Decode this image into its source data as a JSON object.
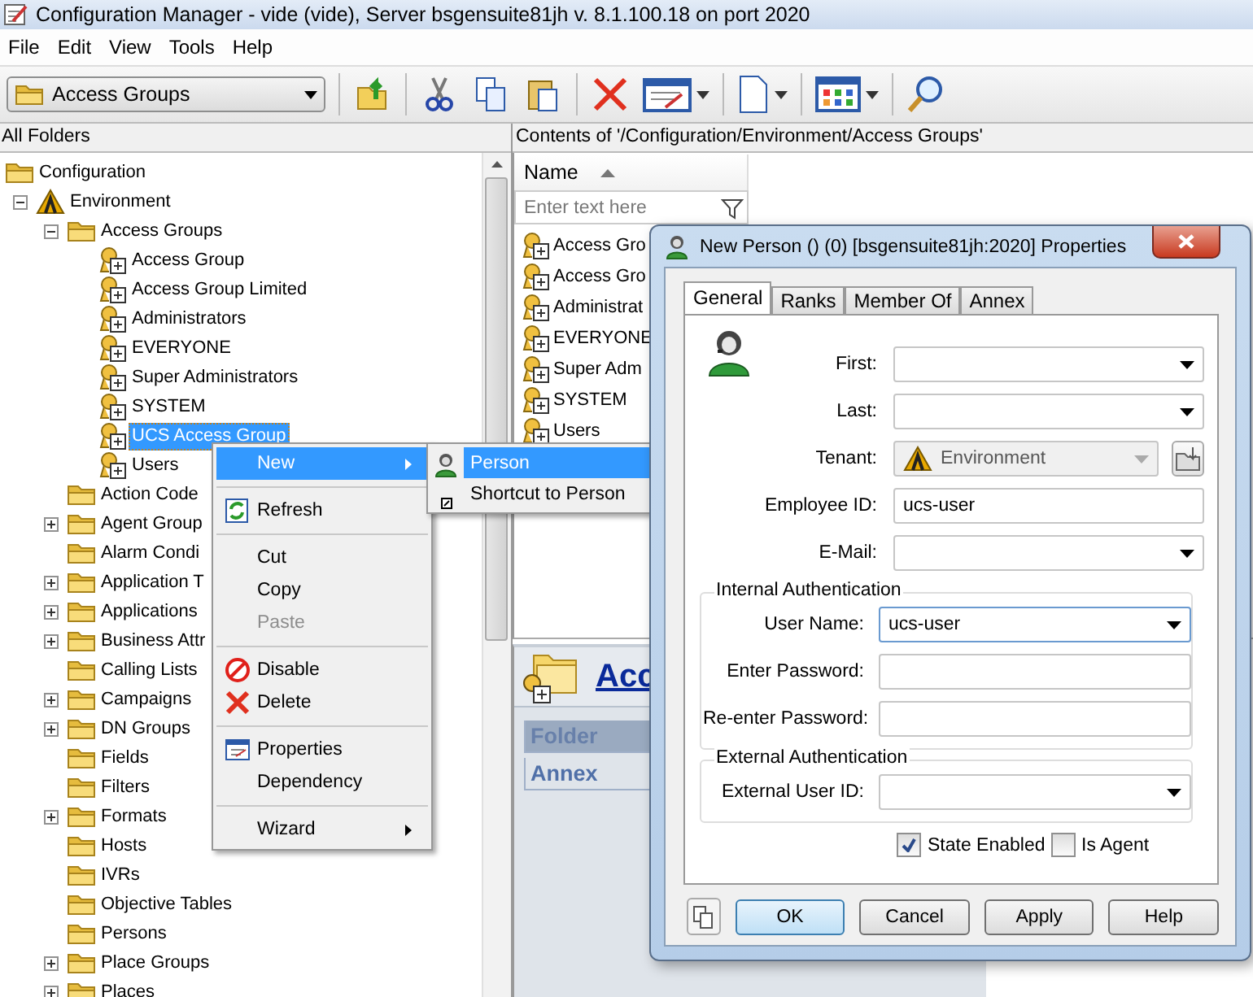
{
  "window": {
    "title": "Configuration Manager - vide  (vide), Server bsgensuite81jh v. 8.1.100.18 on port 2020"
  },
  "menu_bar": [
    "File",
    "Edit",
    "View",
    "Tools",
    "Help"
  ],
  "toolbar": {
    "folder_selector": "Access Groups"
  },
  "folders_pane": {
    "title": "All Folders",
    "tree": [
      {
        "label": "Configuration",
        "kind": "folder",
        "selected": false,
        "children": [
          {
            "label": "Environment",
            "kind": "tenant",
            "selected": false,
            "expanded": true,
            "children": [
              {
                "label": "Access Groups",
                "kind": "folder",
                "selected": false,
                "expanded": true,
                "children": [
                  {
                    "label": "Access Group",
                    "kind": "access-group",
                    "selected": false
                  },
                  {
                    "label": "Access Group Limited",
                    "kind": "access-group",
                    "selected": false
                  },
                  {
                    "label": "Administrators",
                    "kind": "access-group",
                    "selected": false
                  },
                  {
                    "label": "EVERYONE",
                    "kind": "access-group",
                    "selected": false
                  },
                  {
                    "label": "Super Administrators",
                    "kind": "access-group",
                    "selected": false
                  },
                  {
                    "label": "SYSTEM",
                    "kind": "access-group",
                    "selected": false
                  },
                  {
                    "label": "UCS Access Group",
                    "kind": "access-group",
                    "selected": true
                  },
                  {
                    "label": "Users",
                    "kind": "access-group",
                    "selected": false
                  }
                ]
              },
              {
                "label": "Action Code",
                "kind": "folder",
                "selected": false
              },
              {
                "label": "Agent Group",
                "kind": "folder",
                "selected": false,
                "expanded": false
              },
              {
                "label": "Alarm Condi",
                "kind": "folder",
                "selected": false
              },
              {
                "label": "Application T",
                "kind": "folder",
                "selected": false,
                "expanded": false
              },
              {
                "label": "Applications",
                "kind": "folder",
                "selected": false,
                "expanded": false
              },
              {
                "label": "Business Attr",
                "kind": "folder",
                "selected": false,
                "expanded": false
              },
              {
                "label": "Calling Lists",
                "kind": "folder",
                "selected": false
              },
              {
                "label": "Campaigns",
                "kind": "folder",
                "selected": false,
                "expanded": false
              },
              {
                "label": "DN Groups",
                "kind": "folder",
                "selected": false,
                "expanded": false
              },
              {
                "label": "Fields",
                "kind": "folder",
                "selected": false
              },
              {
                "label": "Filters",
                "kind": "folder",
                "selected": false
              },
              {
                "label": "Formats",
                "kind": "folder",
                "selected": false,
                "expanded": false
              },
              {
                "label": "Hosts",
                "kind": "folder",
                "selected": false
              },
              {
                "label": "IVRs",
                "kind": "folder",
                "selected": false
              },
              {
                "label": "Objective Tables",
                "kind": "folder",
                "selected": false
              },
              {
                "label": "Persons",
                "kind": "folder",
                "selected": false
              },
              {
                "label": "Place Groups",
                "kind": "folder",
                "selected": false,
                "expanded": false
              },
              {
                "label": "Places",
                "kind": "folder",
                "selected": false,
                "expanded": false
              }
            ]
          }
        ]
      }
    ]
  },
  "contents_pane": {
    "title": "Contents of '/Configuration/Environment/Access Groups'",
    "columns": [
      "Name"
    ],
    "filter_placeholder": "Enter text here",
    "rows": [
      {
        "name": "Access Gro"
      },
      {
        "name": "Access Gro"
      },
      {
        "name": "Administrat"
      },
      {
        "name": "EVERYONE"
      },
      {
        "name": "Super Adm"
      },
      {
        "name": "SYSTEM"
      },
      {
        "name": "Users"
      }
    ]
  },
  "info_panel": {
    "heading": "Acc",
    "links": [
      {
        "label": "Folder",
        "selected": true
      },
      {
        "label": "Annex",
        "selected": false
      }
    ]
  },
  "context_menu": {
    "items": [
      {
        "kind": "item",
        "label": "New",
        "selected": true,
        "disabled": false,
        "submenu": true
      },
      {
        "kind": "separator"
      },
      {
        "kind": "item",
        "label": "Refresh",
        "selected": false,
        "disabled": false,
        "submenu": false
      },
      {
        "kind": "separator"
      },
      {
        "kind": "item",
        "label": "Cut",
        "selected": false,
        "disabled": false,
        "submenu": false
      },
      {
        "kind": "item",
        "label": "Copy",
        "selected": false,
        "disabled": false,
        "submenu": false
      },
      {
        "kind": "item",
        "label": "Paste",
        "selected": false,
        "disabled": true,
        "submenu": false
      },
      {
        "kind": "separator"
      },
      {
        "kind": "item",
        "label": "Disable",
        "selected": false,
        "disabled": false,
        "submenu": false
      },
      {
        "kind": "item",
        "label": "Delete",
        "selected": false,
        "disabled": false,
        "submenu": false
      },
      {
        "kind": "separator"
      },
      {
        "kind": "item",
        "label": "Properties",
        "selected": false,
        "disabled": false,
        "submenu": false
      },
      {
        "kind": "item",
        "label": "Dependency",
        "selected": false,
        "disabled": false,
        "submenu": false
      },
      {
        "kind": "separator"
      },
      {
        "kind": "item",
        "label": "Wizard",
        "selected": false,
        "disabled": false,
        "submenu": true
      }
    ]
  },
  "submenu": {
    "items": [
      {
        "label": "Person",
        "selected": true
      },
      {
        "label": "Shortcut to Person",
        "selected": false
      }
    ]
  },
  "dialog": {
    "title": "New Person  () (0) [bsgensuite81jh:2020] Properties",
    "tabs": [
      {
        "label": "General",
        "selected": true
      },
      {
        "label": "Ranks",
        "selected": false
      },
      {
        "label": "Member Of",
        "selected": false
      },
      {
        "label": "Annex",
        "selected": false
      }
    ],
    "fields": [
      {
        "label": "First:",
        "kind": "dropdown",
        "disabled": false,
        "focused": false
      },
      {
        "label": "Last:",
        "kind": "dropdown",
        "disabled": false,
        "focused": false
      },
      {
        "label": "Tenant:",
        "kind": "tenant",
        "value": "Environment",
        "disabled": true,
        "focused": false
      },
      {
        "label": "Employee ID:",
        "kind": "text",
        "value": "ucs-user",
        "disabled": false,
        "focused": false
      },
      {
        "label": "E-Mail:",
        "kind": "dropdown",
        "disabled": false,
        "focused": false
      }
    ],
    "groups": [
      {
        "title": "Internal Authentication",
        "fields": [
          {
            "label": "User Name:",
            "kind": "dropdown",
            "value": "ucs-user",
            "disabled": false,
            "focused": true
          },
          {
            "label": "Enter Password:",
            "kind": "text",
            "disabled": false,
            "focused": false
          },
          {
            "label": "Re-enter Password:",
            "kind": "text",
            "disabled": false,
            "focused": false
          }
        ]
      },
      {
        "title": "External Authentication",
        "fields": [
          {
            "label": "External User ID:",
            "kind": "dropdown",
            "disabled": false,
            "focused": false
          }
        ]
      }
    ],
    "checkboxes": [
      {
        "label": "State Enabled",
        "checked": true
      },
      {
        "label": "Is Agent",
        "checked": false
      }
    ],
    "buttons": [
      {
        "label": "OK",
        "default": true
      },
      {
        "label": "Cancel",
        "default": false
      },
      {
        "label": "Apply",
        "default": false
      },
      {
        "label": "Help",
        "default": false
      }
    ]
  }
}
